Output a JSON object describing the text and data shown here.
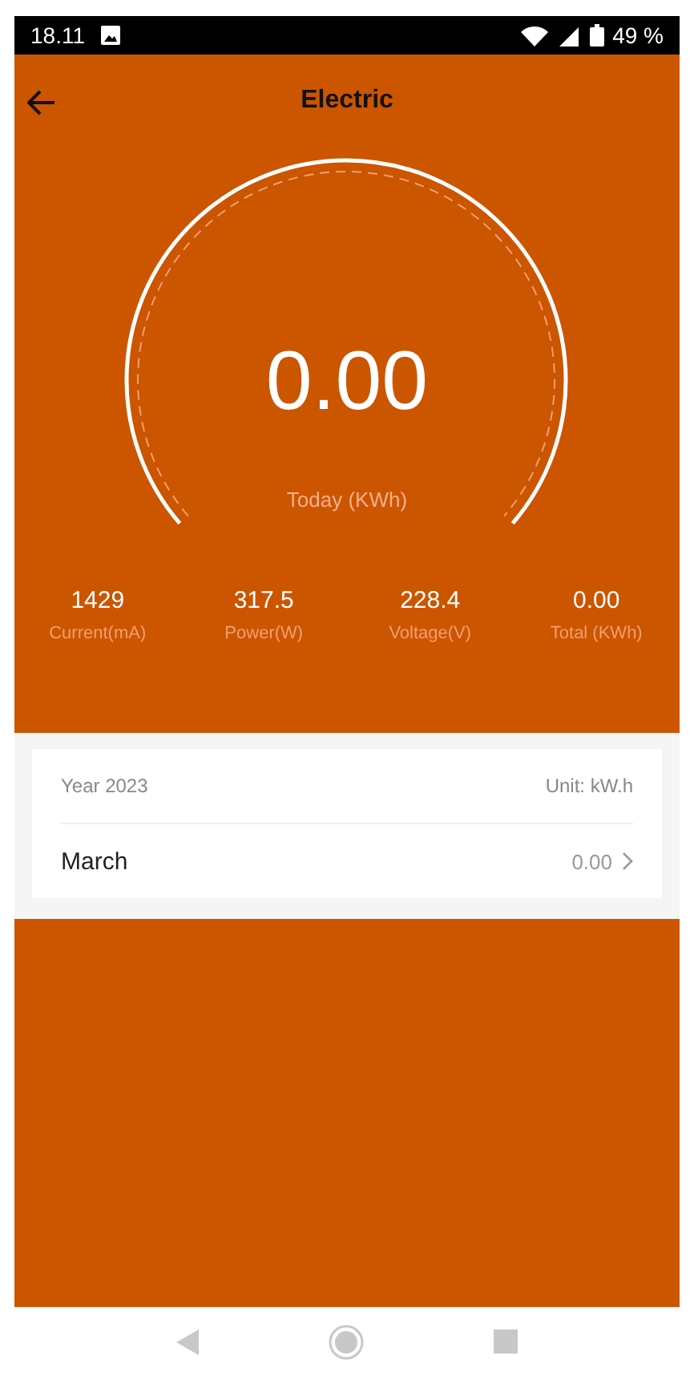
{
  "status_bar": {
    "time": "18.11",
    "battery": "49 %"
  },
  "header": {
    "title": "Electric"
  },
  "gauge": {
    "value": "0.00",
    "label": "Today (KWh)"
  },
  "stats": [
    {
      "value": "1429",
      "label": "Current(mA)"
    },
    {
      "value": "317.5",
      "label": "Power(W)"
    },
    {
      "value": "228.4",
      "label": "Voltage(V)"
    },
    {
      "value": "0.00",
      "label": "Total (KWh)"
    }
  ],
  "history": {
    "year": "Year 2023",
    "unit": "Unit: kW.h",
    "rows": [
      {
        "month": "March",
        "value": "0.00"
      }
    ]
  }
}
